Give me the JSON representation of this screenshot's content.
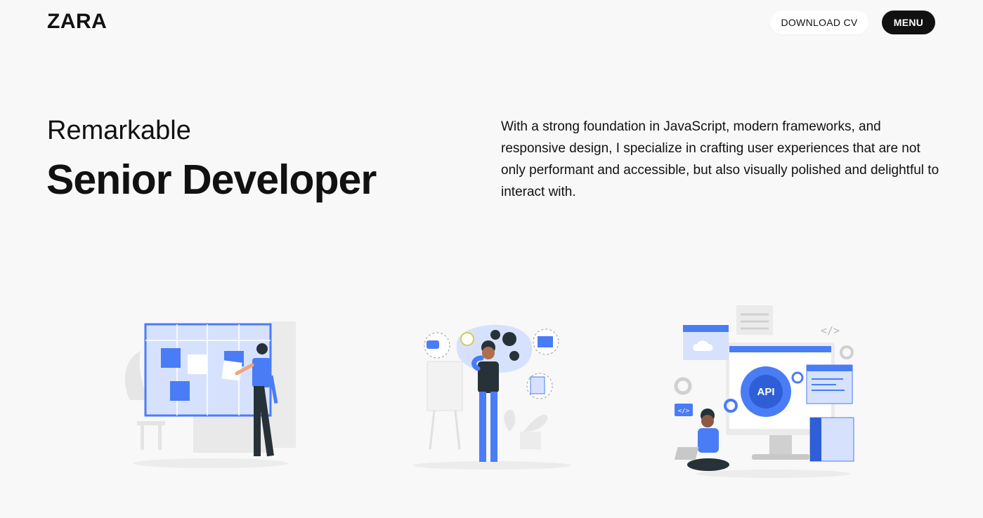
{
  "header": {
    "logo": "ZARA",
    "download_cv_label": "DOWNLOAD CV",
    "menu_label": "MENU"
  },
  "hero": {
    "eyebrow": "Remarkable",
    "title": "Senior Developer",
    "description": "With a strong foundation in JavaScript, modern frameworks, and responsive design, I specialize in crafting user experiences that are not only performant and accessible, but also visually polished and delightful to interact with."
  },
  "illustrations": {
    "api_label": "API",
    "code_tag": "</>",
    "colors": {
      "accent": "#4a7cf5",
      "accent_light": "#d6e2fd",
      "dark": "#263238",
      "grey": "#e4e4e4"
    }
  }
}
